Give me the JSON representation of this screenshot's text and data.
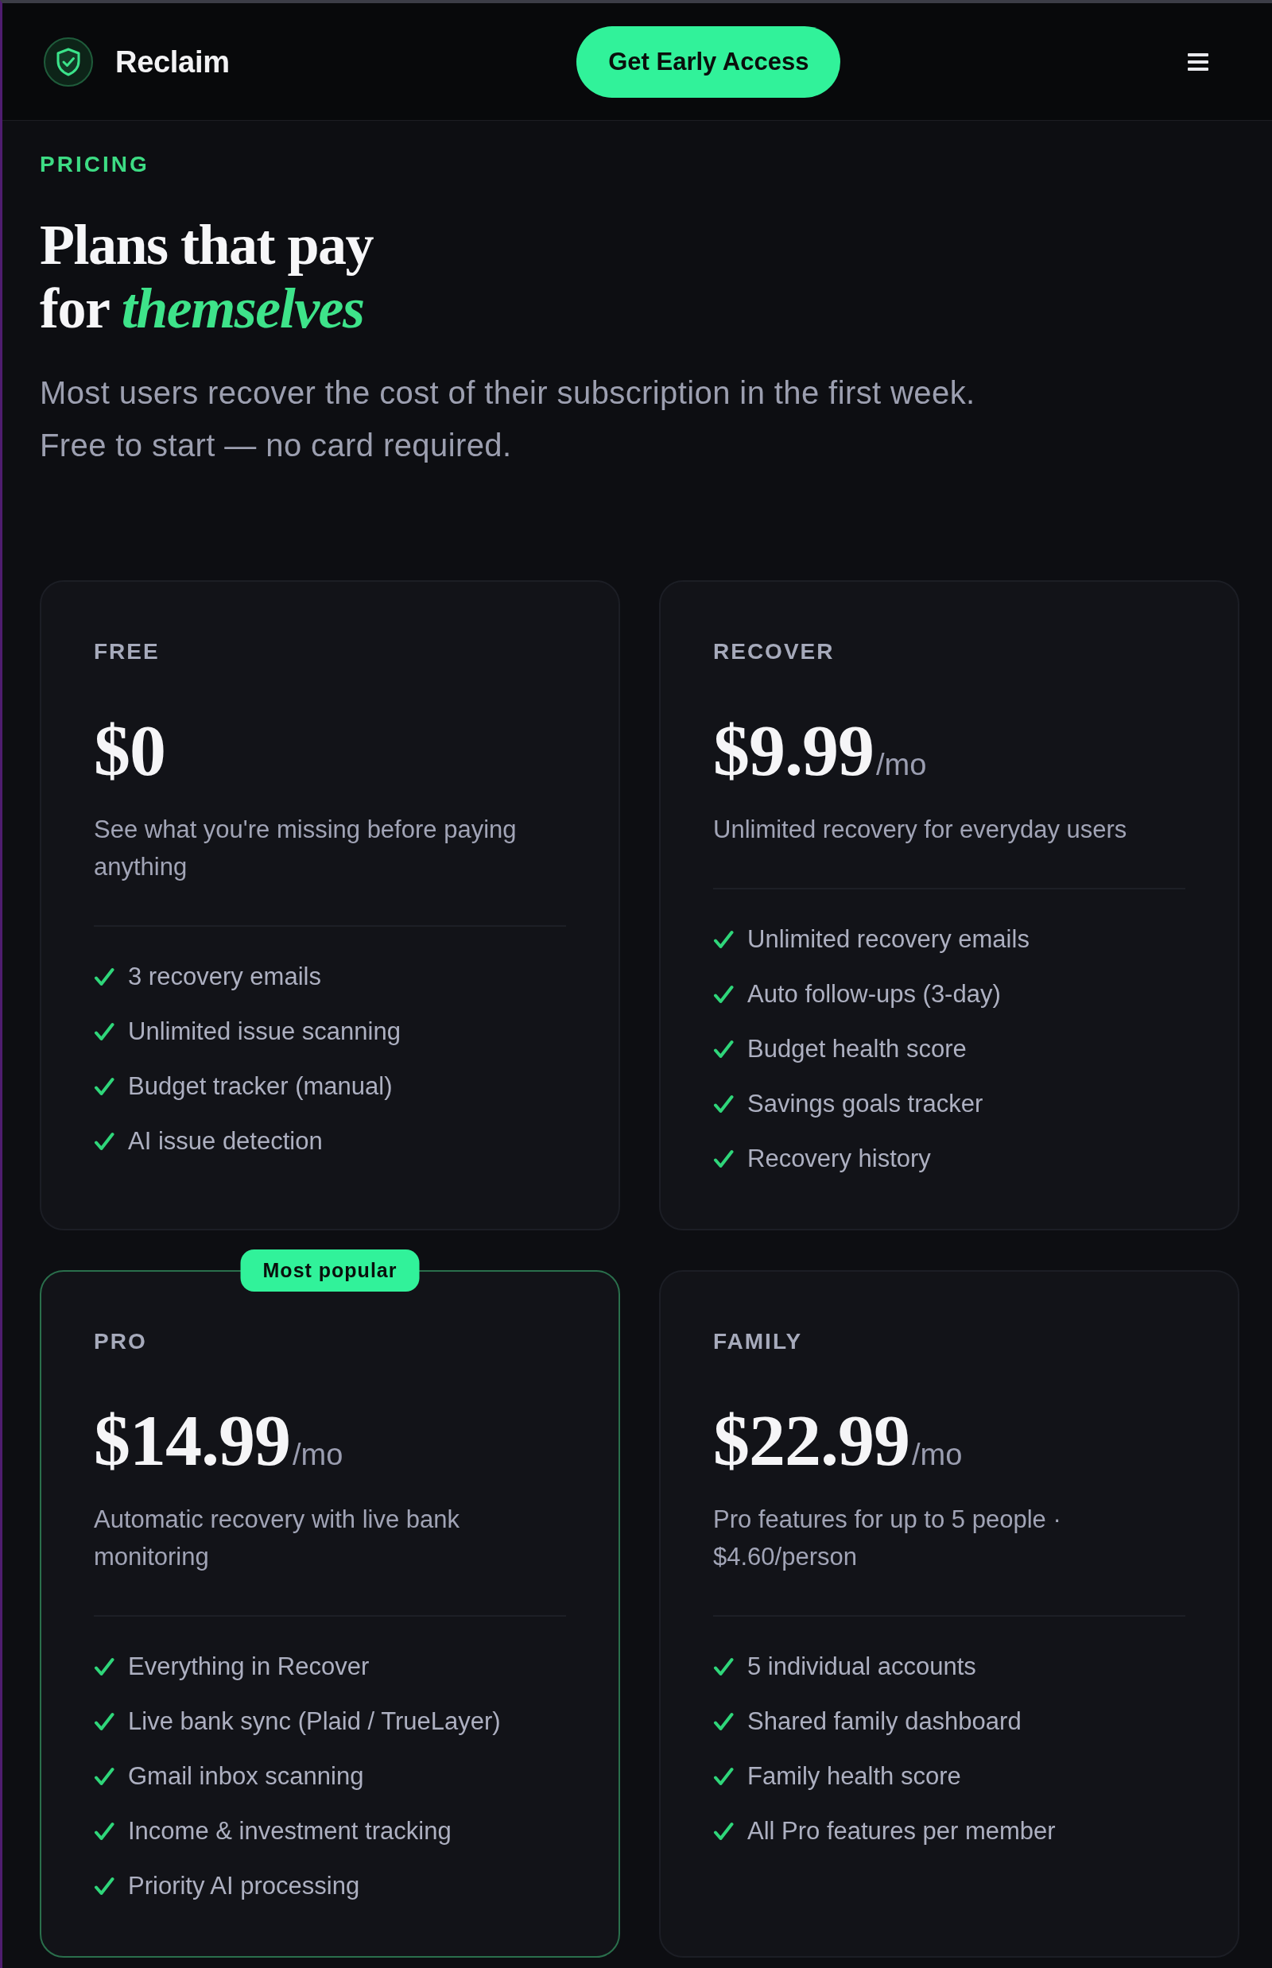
{
  "header": {
    "brand": "Reclaim",
    "cta": "Get Early Access"
  },
  "hero": {
    "eyebrow": "PRICING",
    "title_lines": [
      "Plans that pay",
      "for *themselves*"
    ],
    "subtitle_lines": [
      "Most users recover the cost of their subscription in the first week.",
      "Free to start — no card required."
    ]
  },
  "plans": [
    {
      "name": "FREE",
      "price": "$0",
      "description": "See what you're missing before paying anything",
      "highlighted": false,
      "features": [
        "3 recovery emails",
        "Unlimited issue scanning",
        "Budget tracker (manual)",
        "AI issue detection"
      ]
    },
    {
      "name": "RECOVER",
      "price": "$9.99",
      "period": "/mo",
      "description": "Unlimited recovery for everyday users",
      "highlighted": false,
      "features": [
        "Unlimited recovery emails",
        "Auto follow-ups (3-day)",
        "Budget health score",
        "Savings goals tracker",
        "Recovery history"
      ]
    },
    {
      "name": "PRO",
      "badge": "Most popular",
      "price": "$14.99",
      "period": "/mo",
      "description": "Automatic recovery with live bank monitoring",
      "highlighted": true,
      "features": [
        "Everything in Recover",
        "Live bank sync (Plaid / TrueLayer)",
        "Gmail inbox scanning",
        "Income & investment tracking",
        "Priority AI processing"
      ]
    },
    {
      "name": "FAMILY",
      "price": "$22.99",
      "period": "/mo",
      "description": "Pro features for up to 5 people · $4.60/person",
      "highlighted": false,
      "features": [
        "5 individual accounts",
        "Shared family dashboard",
        "Family health score",
        "All Pro features per member"
      ]
    }
  ]
}
